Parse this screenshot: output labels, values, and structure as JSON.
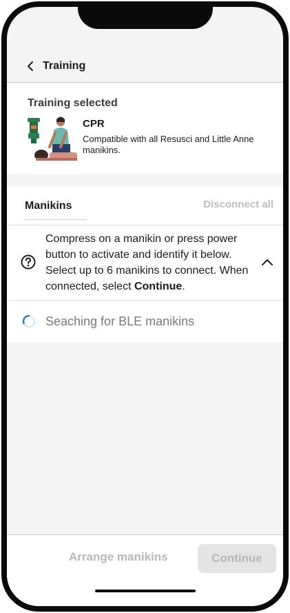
{
  "header": {
    "title": "Training",
    "back_icon": "chevron-left-icon"
  },
  "training": {
    "section_label": "Training selected",
    "name": "CPR",
    "description": "Compatible with all Resusci and Little Anne manikins.",
    "illustration": "cpr-training-illustration"
  },
  "manikins": {
    "title": "Manikins",
    "disconnect_all": "Disconnect all",
    "info": {
      "text_before": "Compress on a manikin or press power button to activate and identify it below. Select up to 6 manikins to connect. When connected, select ",
      "text_bold": "Continue",
      "text_after": ".",
      "icon": "help-circle-icon",
      "toggle_icon": "chevron-up-icon"
    },
    "search_status": "Seaching for BLE manikins"
  },
  "footer": {
    "arrange_label": "Arrange manikins",
    "continue_label": "Continue"
  },
  "colors": {
    "accent": "#2b7cc4",
    "disabled_text": "#b8b8b8",
    "disabled_bg": "#e4e4e4"
  }
}
